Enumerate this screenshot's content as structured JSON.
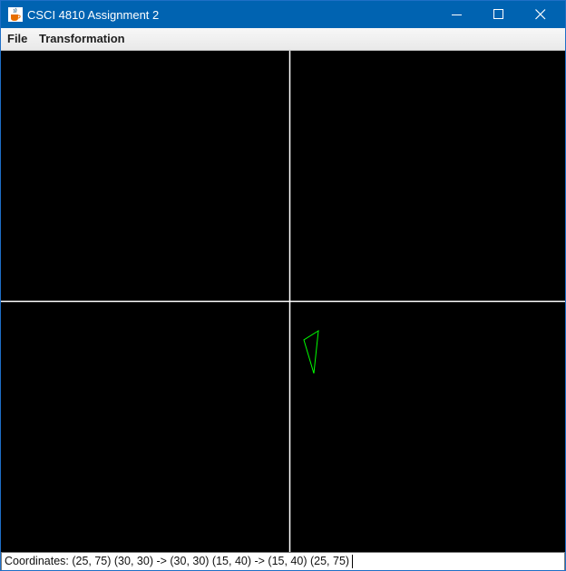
{
  "window": {
    "title": "CSCI 4810 Assignment 2",
    "app_icon": "java-cup-icon"
  },
  "title_buttons": {
    "minimize_icon": "minimize-icon",
    "maximize_icon": "maximize-icon",
    "close_icon": "close-icon"
  },
  "menubar": {
    "items": [
      {
        "label": "File"
      },
      {
        "label": "Transformation"
      }
    ]
  },
  "canvas": {
    "background": "#000000",
    "axis_color": "#ffffff",
    "shape_color": "#00ff00",
    "shape": "triangle"
  },
  "status": {
    "text": "Coordinates: (25, 75) (30, 30) -> (30, 30) (15, 40) -> (15, 40) (25, 75)"
  },
  "colors": {
    "titlebar": "#0063b1",
    "menubar": "#f0f0f0"
  }
}
